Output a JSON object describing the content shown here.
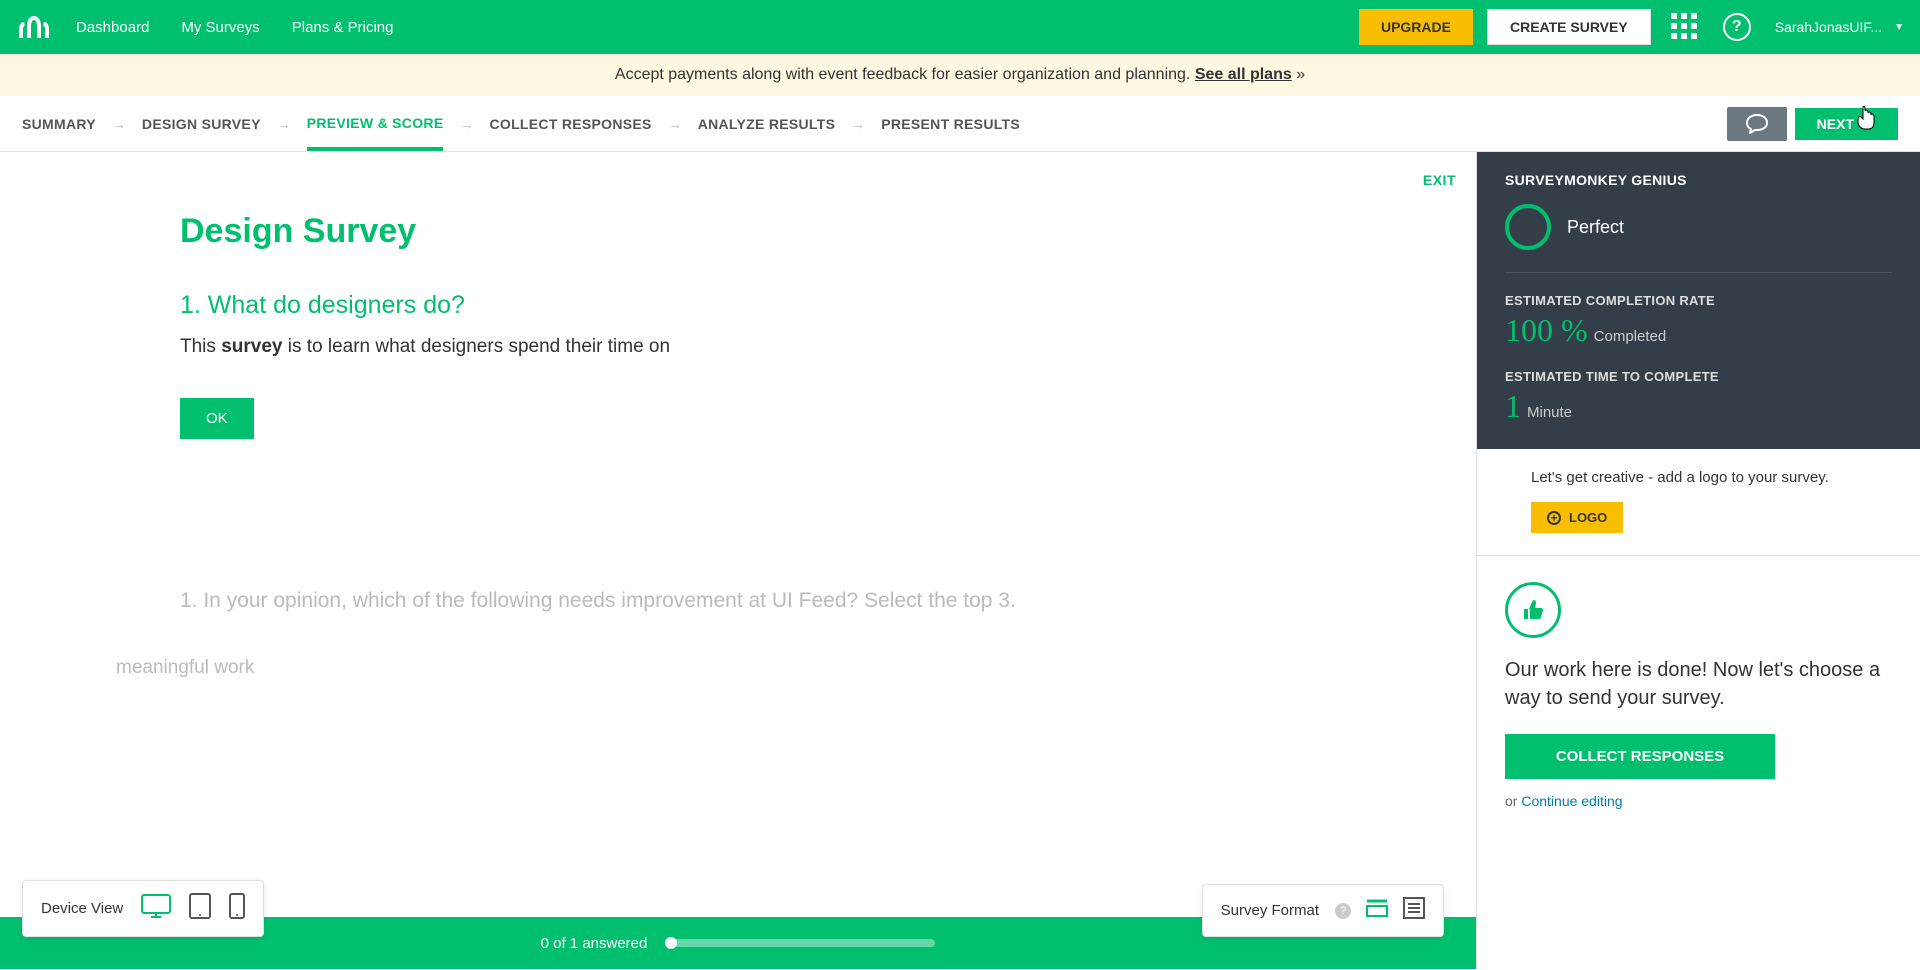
{
  "header": {
    "nav": {
      "dashboard": "Dashboard",
      "my_surveys": "My Surveys",
      "plans": "Plans & Pricing"
    },
    "upgrade": "UPGRADE",
    "create_survey": "CREATE SURVEY",
    "help_glyph": "?",
    "user_name": "SarahJonasUIF..."
  },
  "banner": {
    "text": "Accept payments along with event feedback for easier organization and planning. ",
    "link": "See all plans",
    "suffix": " »"
  },
  "steps": {
    "summary": "SUMMARY",
    "design": "DESIGN SURVEY",
    "preview": "PREVIEW & SCORE",
    "collect": "COLLECT RESPONSES",
    "analyze": "ANALYZE RESULTS",
    "present": "PRESENT RESULTS",
    "next": "NEXT"
  },
  "preview": {
    "exit": "EXIT",
    "survey_title": "Design Survey",
    "q1_title": "1. What do designers do?",
    "q1_desc_pre": "This ",
    "q1_desc_bold": "survey",
    "q1_desc_post": " is to learn what designers spend their time on",
    "ok": "OK",
    "faded_q": "1. In your opinion, which of the following needs improvement at UI Feed? Select the top 3.",
    "faded_opt": "meaningful work",
    "progress": "0 of 1 answered"
  },
  "device_view": {
    "label": "Device View"
  },
  "survey_format": {
    "label": "Survey Format"
  },
  "sidebar": {
    "genius_title": "SURVEYMONKEY GENIUS",
    "status": "Perfect",
    "completion_label": "ESTIMATED COMPLETION RATE",
    "completion_value": "100 %",
    "completion_suffix": "Completed",
    "time_label": "ESTIMATED TIME TO COMPLETE",
    "time_value": "1",
    "time_suffix": "Minute",
    "tip_text": "Let's get creative - add a logo to your survey.",
    "logo_btn": "LOGO",
    "done_text": "Our work here is done! Now let's choose a way to send your survey.",
    "collect_btn": "COLLECT RESPONSES",
    "continue_pre": "or ",
    "continue_link": "Continue editing"
  }
}
